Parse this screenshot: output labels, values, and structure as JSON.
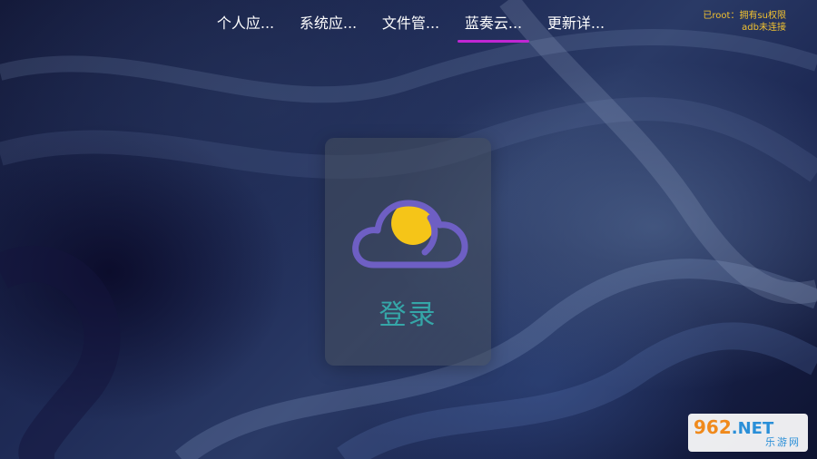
{
  "tabs": [
    {
      "label": "个人应..."
    },
    {
      "label": "系统应..."
    },
    {
      "label": "文件管..."
    },
    {
      "label": "蓝奏云..."
    },
    {
      "label": "更新详..."
    }
  ],
  "active_tab_index": 3,
  "status": {
    "root": "已root：拥有su权限",
    "adb": "adb未连接"
  },
  "login_card": {
    "label": "登录",
    "icon": "cloud-moon-icon"
  },
  "colors": {
    "tab_indicator": "#c026d3",
    "status_text": "#f2c230",
    "login_label": "#35a6a8",
    "cloud_outline": "#6e5fc4",
    "cloud_sun": "#f5c518"
  },
  "watermark": {
    "main": "962",
    "suffix": ".NET",
    "sub": "乐游网"
  }
}
